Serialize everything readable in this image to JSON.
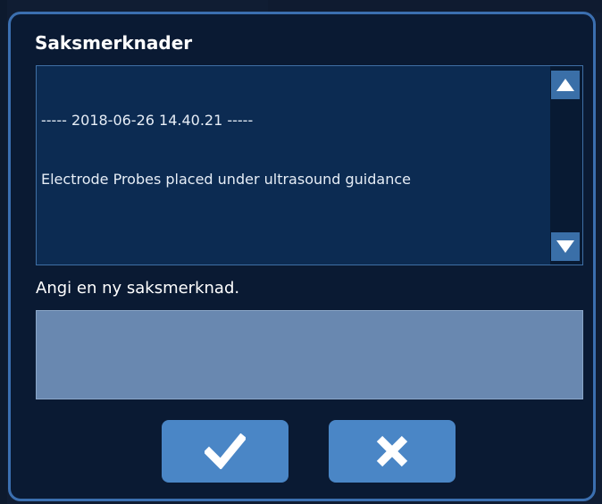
{
  "dialog": {
    "title": "Saksmerknader",
    "log": {
      "header": "----- 2018-06-26 14.40.21 -----",
      "entry": "Electrode Probes placed under ultrasound guidance"
    },
    "scroll_up_icon": "triangle-up-icon",
    "scroll_down_icon": "triangle-down-icon",
    "prompt_label": "Angi en ny saksmerknad.",
    "note_input": {
      "value": "",
      "placeholder": ""
    },
    "confirm_icon": "checkmark-icon",
    "cancel_icon": "close-x-icon"
  },
  "colors": {
    "dialog_bg": "#0a1a33",
    "dialog_border": "#3b6fb0",
    "log_bg": "#0c2b52",
    "input_bg": "#6988b0",
    "button_bg": "#4a86c6",
    "scroll_button": "#3a6fa8"
  }
}
